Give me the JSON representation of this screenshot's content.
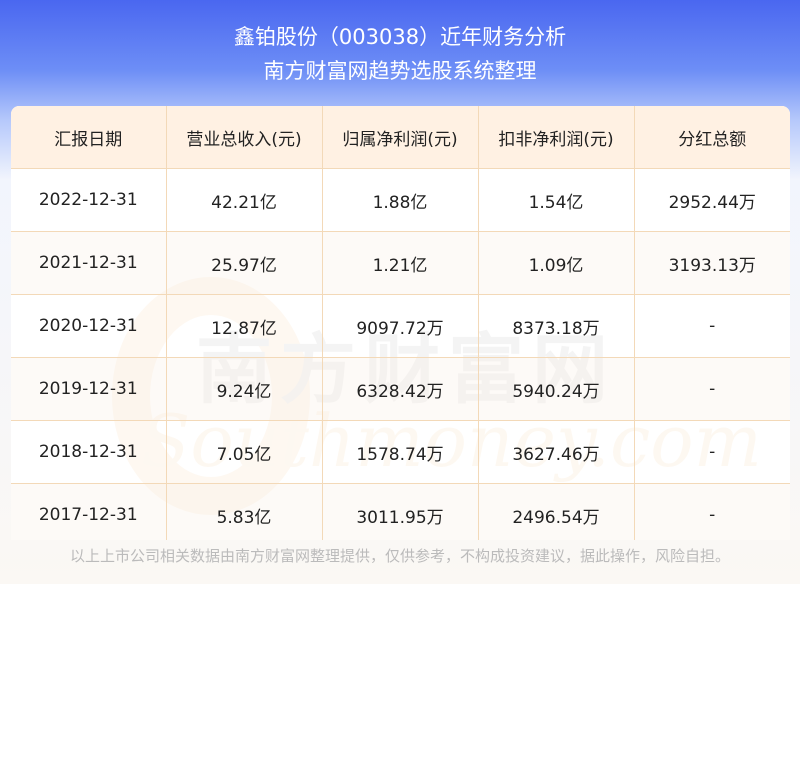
{
  "header": {
    "title": "鑫铂股份（003038）近年财务分析",
    "subtitle": "南方财富网趋势选股系统整理"
  },
  "table": {
    "columns": [
      "汇报日期",
      "营业总收入(元)",
      "归属净利润(元)",
      "扣非净利润(元)",
      "分红总额"
    ],
    "rows": [
      [
        "2022-12-31",
        "42.21亿",
        "1.88亿",
        "1.54亿",
        "2952.44万"
      ],
      [
        "2021-12-31",
        "25.97亿",
        "1.21亿",
        "1.09亿",
        "3193.13万"
      ],
      [
        "2020-12-31",
        "12.87亿",
        "9097.72万",
        "8373.18万",
        "-"
      ],
      [
        "2019-12-31",
        "9.24亿",
        "6328.42万",
        "5940.24万",
        "-"
      ],
      [
        "2018-12-31",
        "7.05亿",
        "1578.74万",
        "3627.46万",
        "-"
      ],
      [
        "2017-12-31",
        "5.83亿",
        "3011.95万",
        "2496.54万",
        "-"
      ]
    ]
  },
  "watermark": {
    "cn": "南方财富网",
    "en": "Southmoney.com"
  },
  "footer": {
    "disclaimer": "以上上市公司相关数据由南方财富网整理提供，仅供参考，不构成投资建议，据此操作，风险自担。"
  },
  "colors": {
    "header_gradient_top": "#4a67f0",
    "table_header_bg": "#fff1e3",
    "grid_line": "#f3d9b8"
  }
}
